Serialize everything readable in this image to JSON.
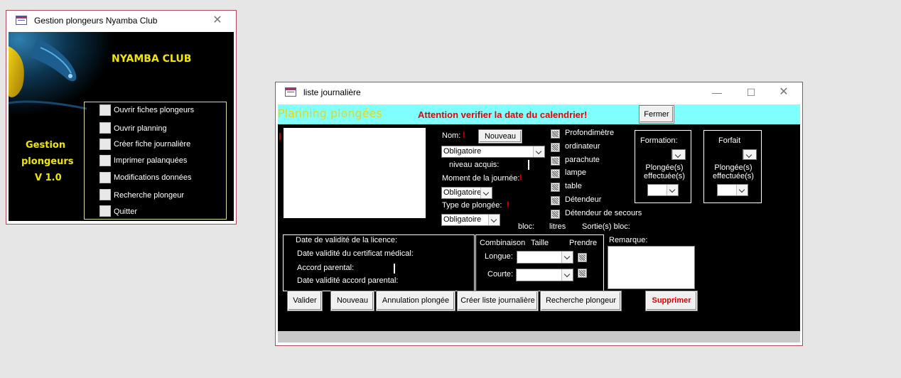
{
  "main_window": {
    "title": "Gestion plongeurs Nyamba Club",
    "club_name": "NYAMBA CLUB",
    "app_name_line1": "Gestion",
    "app_name_line2": "plongeurs",
    "version": "V 1.0",
    "menu": [
      {
        "label": "Ouvrir fiches plongeurs"
      },
      {
        "label": "Ouvrir planning"
      },
      {
        "label": "Créer fiche journalière"
      },
      {
        "label": "Imprimer palanquées"
      },
      {
        "label": "Modifications données"
      },
      {
        "label": "Recherche plongeur"
      },
      {
        "label": "Quitter"
      }
    ]
  },
  "daily_window": {
    "title": "liste journalière",
    "header_title": "Planning plongées",
    "warning": "Attention verifier la date du calendrier!",
    "close_label": "Fermer",
    "nom_label": "Nom:",
    "required_mark": "!",
    "nouveau_small": "Nouveau",
    "nom_value": "Obligatoire",
    "niveau_label": "niveau acquis:",
    "moment_label": "Moment de la journée:",
    "moment_value": "Obligatoire",
    "type_label": "Type de plongée:",
    "type_value": "Obligatoire",
    "equipment": [
      {
        "label": "Profondimètre"
      },
      {
        "label": "ordinateur"
      },
      {
        "label": "parachute"
      },
      {
        "label": "lampe"
      },
      {
        "label": "table"
      },
      {
        "label": "Détendeur"
      },
      {
        "label": "Détendeur de secours"
      }
    ],
    "formation_label": "Formation:",
    "formation_plongees_label": "Plongée(s) effectuée(s)",
    "forfait_label": "Forfait",
    "forfait_plongees_label": "Plongée(s) effectuée(s)",
    "bloc_label": "bloc:",
    "litres_label": "litres",
    "sorties_label": "Sortie(s) bloc:",
    "licence_label": "Date de  validité de la licence:",
    "certificat_label": "Date validité du certificat médical:",
    "accord_label": "Accord parental:",
    "accord_date_label": "Date validité accord parental:",
    "combinaison_label": "Combinaison",
    "taille_label": "Taille",
    "prendre_label": "Prendre",
    "longue_label": "Longue:",
    "courte_label": "Courte:",
    "remarque_label": "Remarque:",
    "buttons": {
      "valider": "Valider",
      "nouveau": "Nouveau",
      "annulation": "Annulation plongée",
      "creer_liste": "Créer liste journalière",
      "recherche": "Recherche plongeur",
      "supprimer": "Supprimer"
    }
  }
}
